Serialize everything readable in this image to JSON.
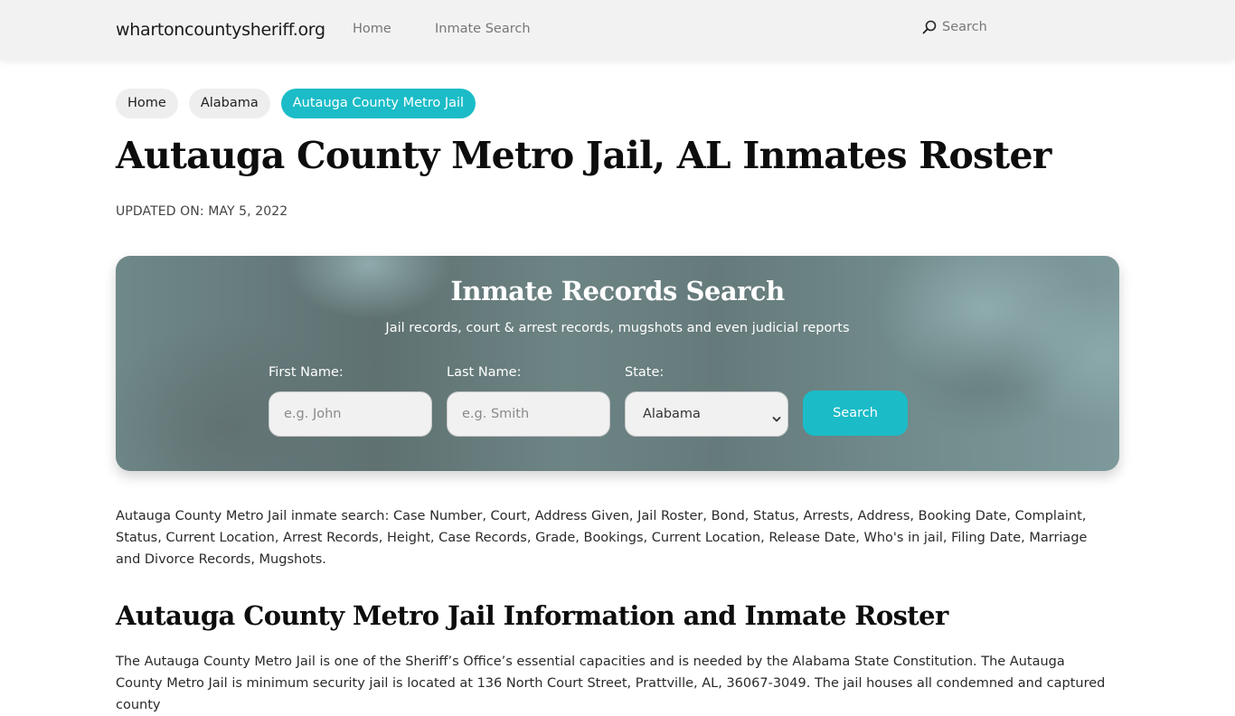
{
  "header": {
    "brand": "whartoncountysheriff.org",
    "nav": [
      {
        "label": "Home"
      },
      {
        "label": "Inmate Search"
      }
    ],
    "search_label": "Search",
    "search_icon": "search-icon"
  },
  "breadcrumb": [
    {
      "label": "Home",
      "active": false
    },
    {
      "label": "Alabama",
      "active": false
    },
    {
      "label": "Autauga County Metro Jail",
      "active": true
    }
  ],
  "page": {
    "title": "Autauga County Metro Jail, AL Inmates Roster",
    "updated": "UPDATED ON: MAY 5, 2022"
  },
  "search_card": {
    "title": "Inmate Records Search",
    "subtitle": "Jail records, court & arrest records, mugshots and even judicial reports",
    "first_name": {
      "label": "First Name:",
      "placeholder": "e.g. John",
      "value": ""
    },
    "last_name": {
      "label": "Last Name:",
      "placeholder": "e.g. Smith",
      "value": ""
    },
    "state": {
      "label": "State:",
      "selected": "Alabama",
      "chevron_icon": "chevron-down-icon"
    },
    "button_label": "Search"
  },
  "content": {
    "intro": "Autauga County Metro Jail inmate search: Case Number, Court, Address Given, Jail Roster, Bond, Status, Arrests, Address, Booking Date, Complaint, Status, Current Location, Arrest Records, Height, Case Records, Grade, Bookings, Current Location, Release Date, Who's in jail, Filing Date, Marriage and Divorce Records, Mugshots.",
    "section_title": "Autauga County Metro Jail Information and Inmate Roster",
    "info_paragraph": "The Autauga County Metro Jail is one of the Sheriff’s Office’s essential capacities and is needed by the Alabama State Constitution. The Autauga County Metro Jail is minimum security jail is located at 136 North Court Street, Prattville, AL, 36067-3049. The jail houses all condemned and captured county"
  },
  "colors": {
    "accent": "#1bbcc7",
    "topbar_bg": "#f2f2f2",
    "crumb_bg": "#eeeeee",
    "card_base": "#6a8283"
  }
}
